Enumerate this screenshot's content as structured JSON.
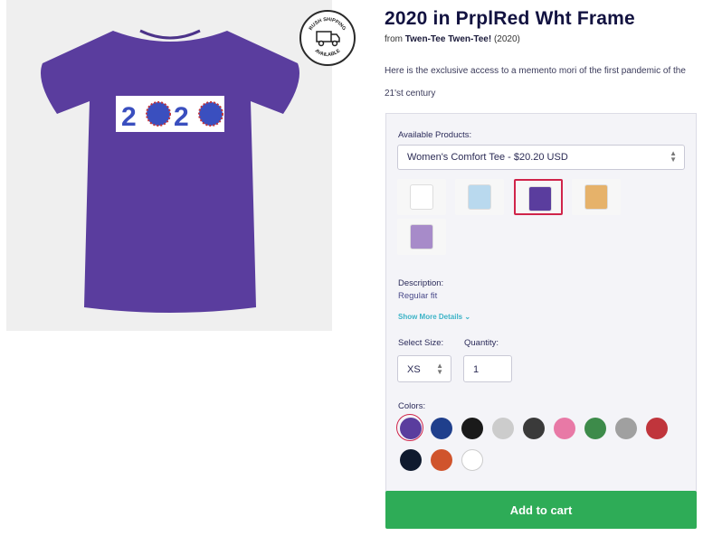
{
  "hero": {
    "print_text": "2020"
  },
  "badge": {
    "top_text": "RUSH SHIPPING",
    "bottom_text": "AVAILABLE"
  },
  "product": {
    "title": "2020 in PrplRed Wht Frame",
    "from_prefix": "from",
    "from_shop": "Twen-Tee Twen-Tee!",
    "from_suffix": "(2020)",
    "description": "Here is the exclusive access to a memento mori of the first pandemic of the 21'st century"
  },
  "options": {
    "products_label": "Available Products:",
    "selected_product": "Women's Comfort Tee - $20.20 USD",
    "thumbnails": [
      {
        "name": "mug",
        "color": "#ffffff",
        "selected": false
      },
      {
        "name": "socks",
        "color": "#b9d9ee",
        "selected": false
      },
      {
        "name": "womens-tee",
        "color": "#5a3d9e",
        "selected": true
      },
      {
        "name": "tank-top",
        "color": "#e6b26a",
        "selected": false
      },
      {
        "name": "socks-purple",
        "color": "#a78bc9",
        "selected": false
      }
    ],
    "description_label": "Description:",
    "description_value": "Regular fit",
    "show_more": "Show More Details",
    "size_label": "Select Size:",
    "size_value": "XS",
    "quantity_label": "Quantity:",
    "quantity_value": "1",
    "colors_label": "Colors:",
    "colors": [
      "#5a3d9e",
      "#1f3f8c",
      "#1a1a1a",
      "#cccccc",
      "#3a3a3a",
      "#e879a6",
      "#3d8b4a",
      "#a0a0a0",
      "#c0353c",
      "#0f1a2e",
      "#d0542c",
      "#ffffff"
    ]
  },
  "cart": {
    "label": "Add to cart"
  }
}
